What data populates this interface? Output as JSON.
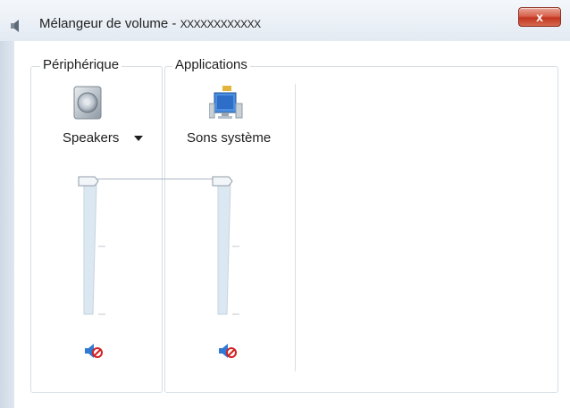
{
  "window": {
    "title": "Mélangeur de volume - ",
    "title_suffix": "XXXXXXXXXXXX",
    "close_label": "x"
  },
  "device_group": {
    "label": "Périphérique",
    "device_name": "Speakers",
    "device_icon": "speaker-icon",
    "volume_level": 1.0,
    "muted": true
  },
  "apps_group": {
    "label": "Applications",
    "apps": [
      {
        "name": "Sons système",
        "icon": "system-sounds-icon",
        "volume_level": 1.0,
        "muted": true
      }
    ]
  },
  "colors": {
    "accent_blue": "#2f78d4",
    "mute_red": "#d41f1f",
    "close_red": "#c3351f"
  }
}
